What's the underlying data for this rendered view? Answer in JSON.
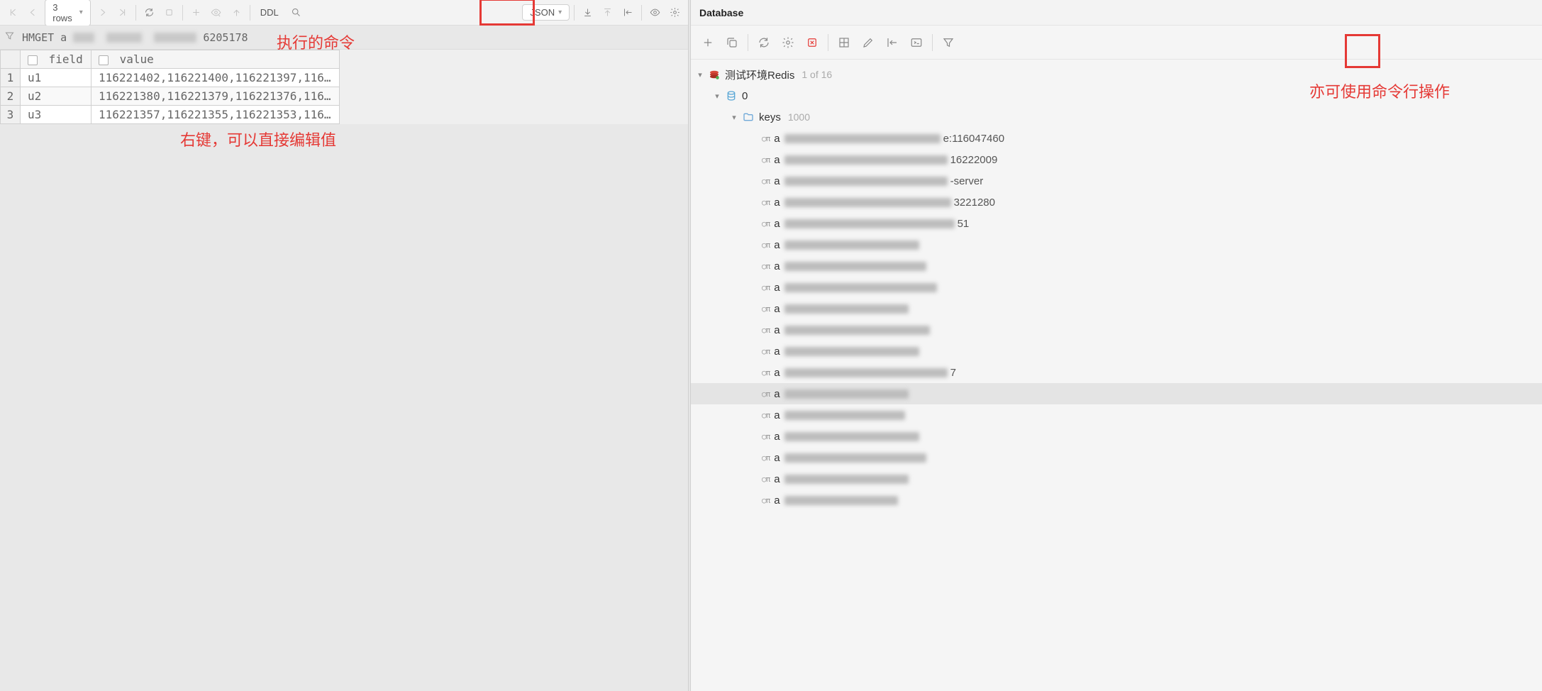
{
  "toolbar": {
    "rows_label": "3 rows",
    "ddl_label": "DDL",
    "format_label": "JSON"
  },
  "cmd": {
    "prefix": "HMGET a",
    "suffix": "6205178"
  },
  "annotations": {
    "cmd_note": "执行的命令",
    "edit_note": "右键，可以直接编辑值",
    "console_note": "亦可使用命令行操作"
  },
  "table": {
    "headers": {
      "field": "field",
      "value": "value"
    },
    "rows": [
      {
        "n": "1",
        "field": "u1",
        "value": "116221402,116221400,116221397,116…"
      },
      {
        "n": "2",
        "field": "u2",
        "value": "116221380,116221379,116221376,116…"
      },
      {
        "n": "3",
        "field": "u3",
        "value": "116221357,116221355,116221353,116…"
      }
    ]
  },
  "database": {
    "panel_title": "Database",
    "datasource": {
      "name": "测试环境Redis",
      "hint": "1 of 16"
    },
    "db_node": {
      "name": "0"
    },
    "keys_node": {
      "name": "keys",
      "count": "1000"
    },
    "keys": [
      {
        "prefix": "a",
        "blur_w": 220,
        "suffix": "e:116047460"
      },
      {
        "prefix": "a",
        "blur_w": 230,
        "suffix": "16222009"
      },
      {
        "prefix": "a",
        "blur_w": 230,
        "suffix": "-server"
      },
      {
        "prefix": "a",
        "blur_w": 235,
        "suffix": "3221280"
      },
      {
        "prefix": "a",
        "blur_w": 240,
        "suffix": "51"
      },
      {
        "prefix": "a",
        "blur_w": 190,
        "suffix": ""
      },
      {
        "prefix": "a",
        "blur_w": 200,
        "suffix": ""
      },
      {
        "prefix": "a",
        "blur_w": 215,
        "suffix": ""
      },
      {
        "prefix": "a",
        "blur_w": 175,
        "suffix": ""
      },
      {
        "prefix": "a",
        "blur_w": 205,
        "suffix": ""
      },
      {
        "prefix": "a",
        "blur_w": 190,
        "suffix": ""
      },
      {
        "prefix": "a",
        "blur_w": 230,
        "suffix": "7"
      },
      {
        "prefix": "a",
        "blur_w": 175,
        "suffix": ""
      },
      {
        "prefix": "a",
        "blur_w": 170,
        "suffix": ""
      },
      {
        "prefix": "a",
        "blur_w": 190,
        "suffix": ""
      },
      {
        "prefix": "a",
        "blur_w": 200,
        "suffix": ""
      },
      {
        "prefix": "a",
        "blur_w": 175,
        "suffix": ""
      },
      {
        "prefix": "a",
        "blur_w": 160,
        "suffix": ""
      }
    ],
    "selected_key_index": 12
  }
}
